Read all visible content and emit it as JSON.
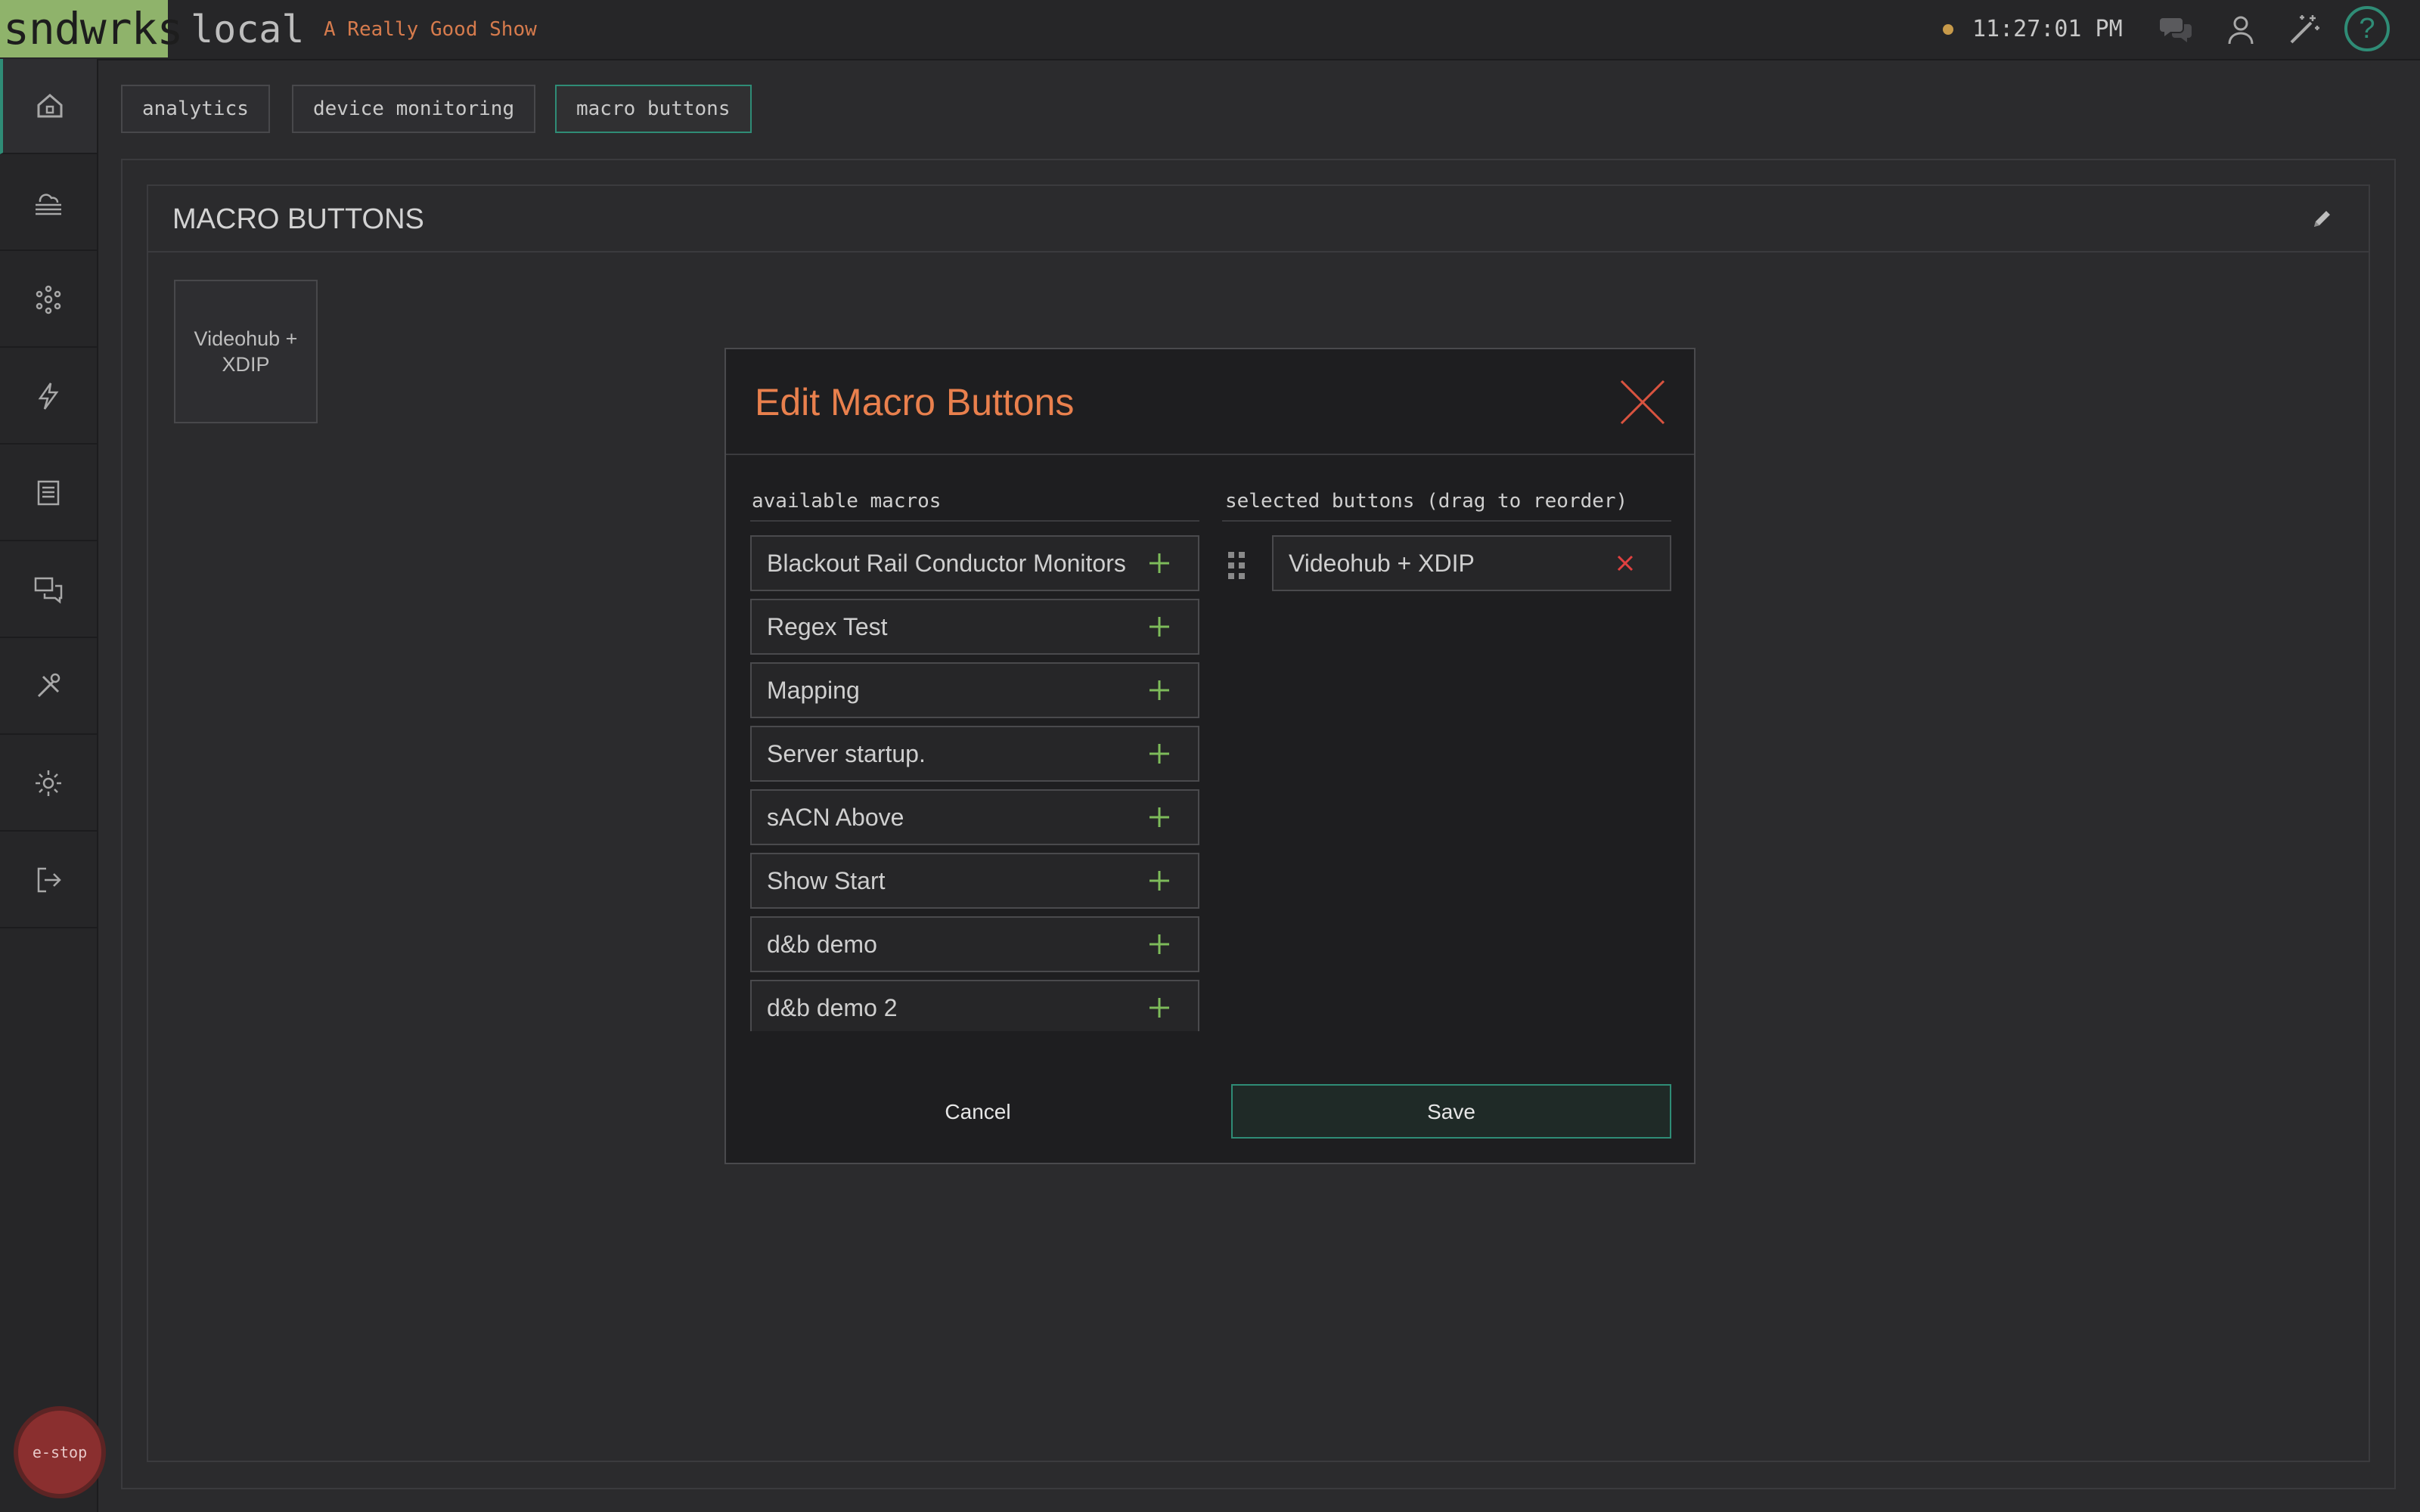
{
  "header": {
    "brand": "sndwrks",
    "environment": "local",
    "show_name": "A Really Good Show",
    "clock": "11:27:01 PM",
    "help_label": "?",
    "status_color": "#c79a4a"
  },
  "sidebar": {
    "items": [
      {
        "icon": "home-icon"
      },
      {
        "icon": "cloud-server-icon"
      },
      {
        "icon": "network-nodes-icon"
      },
      {
        "icon": "lightning-icon"
      },
      {
        "icon": "document-icon"
      },
      {
        "icon": "chat-icon"
      },
      {
        "icon": "tools-icon"
      },
      {
        "icon": "gear-icon"
      },
      {
        "icon": "logout-icon"
      }
    ],
    "estop_label": "e-stop"
  },
  "tabs": [
    {
      "label": "analytics",
      "active": false
    },
    {
      "label": "device monitoring",
      "active": false
    },
    {
      "label": "macro buttons",
      "active": true
    }
  ],
  "card": {
    "title": "MACRO BUTTONS",
    "tiles": [
      "Videohub + XDIP"
    ]
  },
  "modal": {
    "title": "Edit Macro Buttons",
    "available_label": "available macros",
    "selected_label": "selected buttons (drag to reorder)",
    "available_macros": [
      "Blackout Rail Conductor Monitors",
      "Regex Test",
      "Mapping",
      "Server startup.",
      "sACN Above",
      "Show Start",
      "d&b demo",
      "d&b demo 2"
    ],
    "selected_buttons": [
      "Videohub + XDIP"
    ],
    "cancel_label": "Cancel",
    "save_label": "Save"
  },
  "colors": {
    "accent": "#2f8c76",
    "brand": "#8fb36b",
    "title_orange": "#e9804d",
    "add_green": "#7dbb5a",
    "remove_red": "#e04040"
  }
}
